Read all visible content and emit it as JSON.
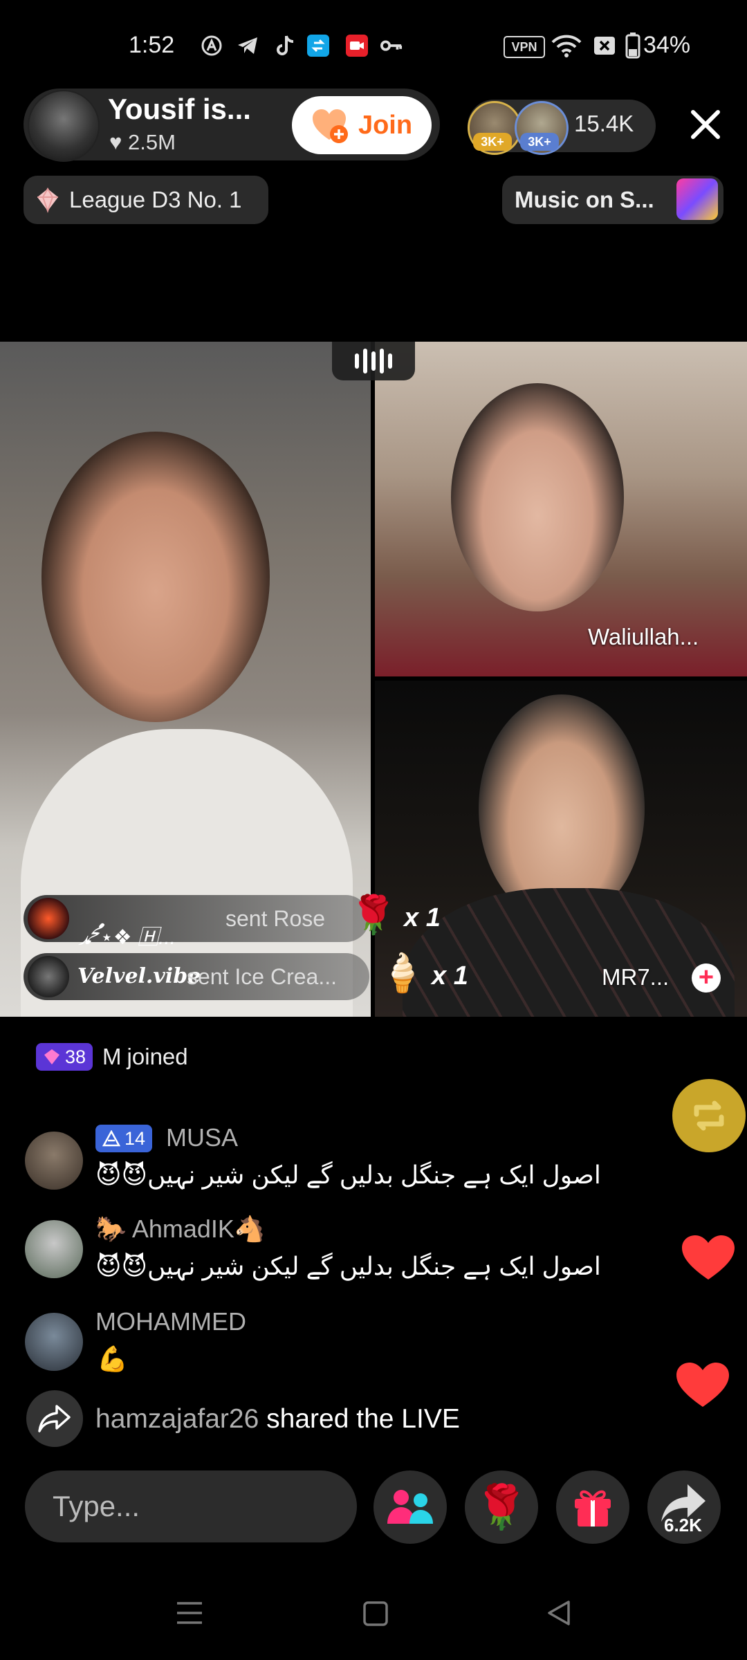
{
  "status_bar": {
    "time": "1:52",
    "icons": [
      "a-icon",
      "telegram-icon",
      "tiktok-icon",
      "sync-icon",
      "record-icon",
      "key-icon",
      "vpn-icon",
      "wifi-icon",
      "no-sim-icon",
      "battery-icon"
    ],
    "vpn_label": "VPN",
    "battery": "34%"
  },
  "host": {
    "name": "Yousif is...",
    "likes": "2.5M",
    "join_label": "Join"
  },
  "viewers": {
    "badge_1": "3K+",
    "badge_2": "3K+",
    "count": "15.4K"
  },
  "league": {
    "label": "League D3 No. 1"
  },
  "music": {
    "label": "Music on S..."
  },
  "video": {
    "top_right_name": "Waliullah...",
    "bottom_right_name": "MR7...",
    "plus": "+"
  },
  "gifts": [
    {
      "user": "ﷴ⋆❖ 🄷...",
      "text": "sent Rose",
      "count": "x 1",
      "gift": "rose"
    },
    {
      "user": "Velvel.vibe",
      "text": "sent Ice Crea...",
      "count": "x 1",
      "gift": "ice-cream"
    }
  ],
  "joined": {
    "level": "38",
    "user": "M",
    "text": "joined"
  },
  "chat": [
    {
      "level": "14",
      "name": "MUSA",
      "message": "اصول ایک ہے جنگل بدلیں گے لیکن شیر نہیں😈😈"
    },
    {
      "level": "",
      "name": "🐎 AhmadIK🐴",
      "message": "اصول ایک ہے جنگل بدلیں گے لیکن شیر نہیں😈😈"
    },
    {
      "level": "",
      "name": "MOHAMMED",
      "message": "💪"
    }
  ],
  "shared": {
    "user": "hamzajafar26",
    "text": "shared the LIVE"
  },
  "composer": {
    "placeholder": "Type..."
  },
  "share_count": "6.2K",
  "colors": {
    "accent_red": "#ff2d55",
    "join_orange": "#ff6a1a",
    "repost_gold": "#c9a62a",
    "level_purple": "#5b35d6"
  }
}
